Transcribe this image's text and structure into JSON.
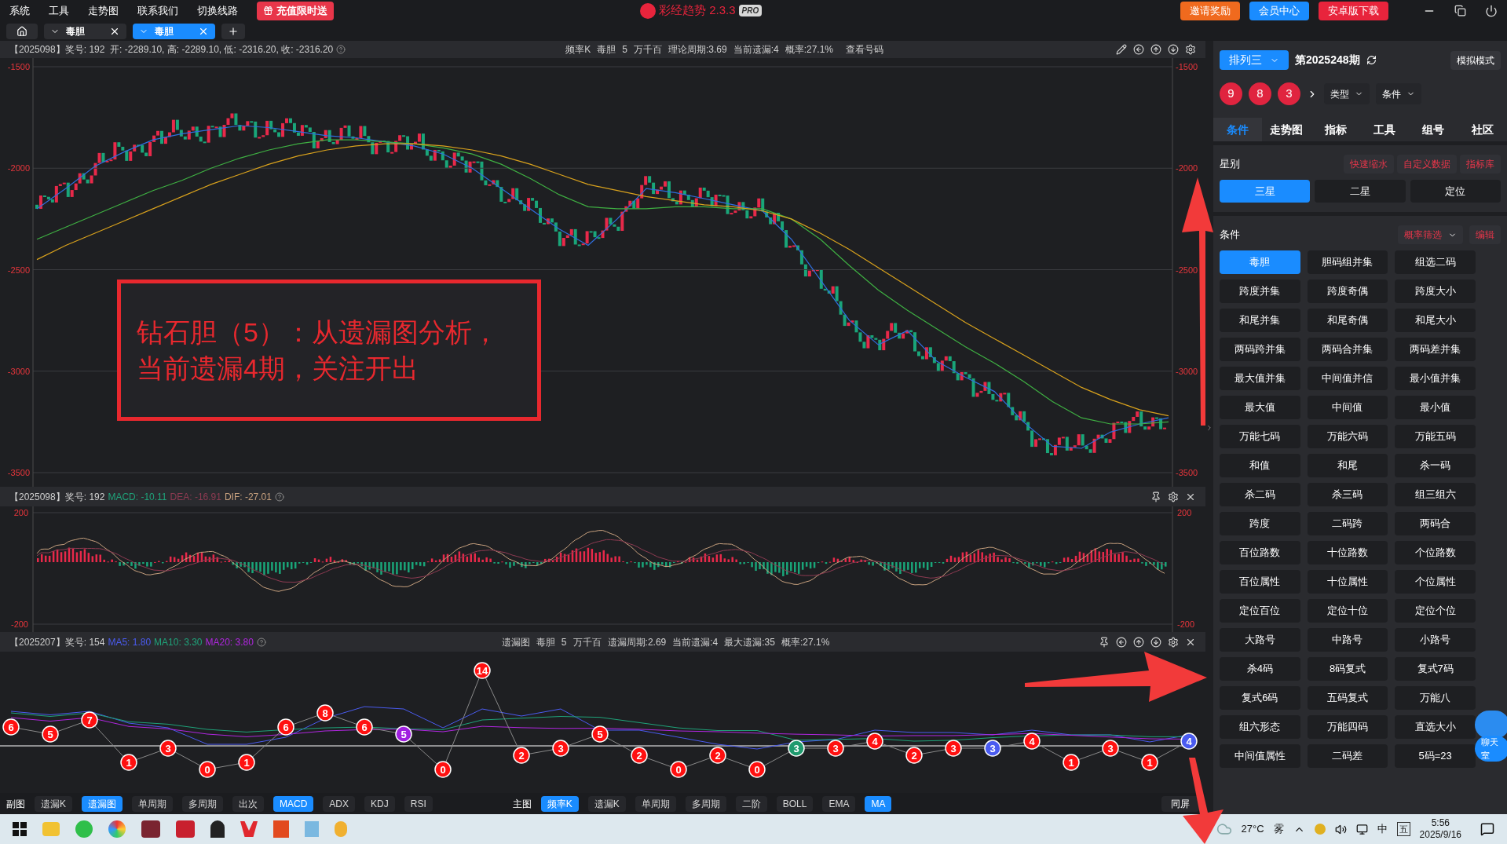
{
  "menu": [
    "系统",
    "工具",
    "走势图",
    "联系我们",
    "切换线路"
  ],
  "promo": "充值限时送",
  "app_title": "彩经趋势 2.3.3",
  "app_badge": "PRO",
  "top_buttons": [
    {
      "label": "邀请奖励",
      "kind": "invite"
    },
    {
      "label": "会员中心",
      "kind": "member"
    },
    {
      "label": "安卓版下载",
      "kind": "download"
    }
  ],
  "doc_tabs": [
    {
      "label": "毒胆",
      "selected": false
    },
    {
      "label": "毒胆",
      "selected": true
    }
  ],
  "main_chart": {
    "info": "【2025098】奖号: 192",
    "ohlc": "开: -2289.10, 高: -2289.10, 低: -2316.20, 收: -2316.20",
    "center": [
      "频率K",
      "毒胆",
      "5",
      "万千百",
      "理论周期:3.69",
      "当前遗漏:4",
      "概率:27.1%"
    ],
    "link": "查看号码",
    "chart_data": {
      "type": "line",
      "grid": true,
      "ylim": [
        -3500,
        -1500
      ],
      "yticks": [
        -1500,
        -2000,
        -2500,
        -3000,
        -3500
      ],
      "series": [
        {
          "color": "#2f6fe0",
          "values": [
            -2200,
            -2100,
            -1990,
            -1920,
            -1860,
            -1830,
            -1810,
            -1790,
            -1800,
            -1820,
            -1840,
            -1850,
            -1870,
            -1890,
            -1930,
            -2000,
            -2100,
            -2200,
            -2300,
            -2380,
            -2250,
            -2100,
            -2120,
            -2150,
            -2180,
            -2210,
            -2350,
            -2550,
            -2750,
            -2870,
            -2800,
            -2950,
            -3030,
            -3100,
            -3250,
            -3370,
            -3380,
            -3300,
            -3260,
            -3230
          ]
        },
        {
          "color": "#3fb043",
          "values": [
            -2350,
            -2290,
            -2230,
            -2170,
            -2110,
            -2060,
            -2000,
            -1950,
            -1910,
            -1880,
            -1860,
            -1860,
            -1870,
            -1880,
            -1900,
            -1930,
            -1980,
            -2050,
            -2130,
            -2190,
            -2200,
            -2200,
            -2190,
            -2190,
            -2200,
            -2200,
            -2250,
            -2350,
            -2480,
            -2600,
            -2700,
            -2790,
            -2880,
            -2960,
            -3050,
            -3150,
            -3230,
            -3260,
            -3260,
            -3250
          ]
        },
        {
          "color": "#d9a21d",
          "values": [
            -2450,
            -2380,
            -2320,
            -2260,
            -2200,
            -2140,
            -2080,
            -2030,
            -1980,
            -1940,
            -1910,
            -1890,
            -1880,
            -1880,
            -1890,
            -1910,
            -1940,
            -1980,
            -2030,
            -2080,
            -2110,
            -2140,
            -2160,
            -2180,
            -2190,
            -2210,
            -2250,
            -2320,
            -2400,
            -2490,
            -2580,
            -2670,
            -2760,
            -2840,
            -2920,
            -3000,
            -3080,
            -3140,
            -3190,
            -3220
          ]
        }
      ]
    },
    "right_ticks": [
      "-1500",
      "-2000",
      "-2500",
      "-3000",
      "-3500"
    ]
  },
  "annotation": [
    "钻石胆（5）：从遗漏图分析，",
    "当前遗漏4期，关注开出"
  ],
  "macd": {
    "info": "【2025098】奖号: 192",
    "indicators": [
      {
        "label": "MACD: -10.11",
        "color": "#1fa37a"
      },
      {
        "label": "DEA: -16.91",
        "color": "#8e3b52"
      },
      {
        "label": "DIF: -27.01",
        "color": "#c9a27f"
      }
    ],
    "left_ticks": [
      "200",
      "-200"
    ],
    "right_ticks": [
      "200",
      "-200"
    ]
  },
  "miss_chart": {
    "info": "【2025207】奖号: 154",
    "indicators": [
      {
        "label": "MA5: 1.80",
        "color": "#4a5bf0"
      },
      {
        "label": "MA10: 3.30",
        "color": "#1fa37a"
      },
      {
        "label": "MA20: 3.80",
        "color": "#b026e0"
      }
    ],
    "center": [
      "遗漏图",
      "毒胆",
      "5",
      "万千百",
      "遗漏周期:2.69",
      "当前遗漏:4",
      "最大遗漏:35",
      "概率:27.1%"
    ],
    "points": [
      {
        "value": "6",
        "color": "#ff1010"
      },
      {
        "value": "5",
        "color": "#ff1010"
      },
      {
        "value": "7",
        "color": "#ff1010"
      },
      {
        "value": "1",
        "color": "#ff1010"
      },
      {
        "value": "3",
        "color": "#ff1010"
      },
      {
        "value": "0",
        "color": "#ff1010"
      },
      {
        "value": "1",
        "color": "#ff1010"
      },
      {
        "value": "6",
        "color": "#ff1010"
      },
      {
        "value": "8",
        "color": "#ff1010"
      },
      {
        "value": "6",
        "color": "#ff1010"
      },
      {
        "value": "5",
        "color": "#a020e0"
      },
      {
        "value": "0",
        "color": "#ff1010"
      },
      {
        "value": "14",
        "color": "#ff1010"
      },
      {
        "value": "2",
        "color": "#ff1010"
      },
      {
        "value": "3",
        "color": "#ff1010"
      },
      {
        "value": "5",
        "color": "#ff1010"
      },
      {
        "value": "2",
        "color": "#ff1010"
      },
      {
        "value": "0",
        "color": "#ff1010"
      },
      {
        "value": "2",
        "color": "#ff1010"
      },
      {
        "value": "0",
        "color": "#ff1010"
      },
      {
        "value": "3",
        "color": "#1f9a6e"
      },
      {
        "value": "3",
        "color": "#ff1010"
      },
      {
        "value": "4",
        "color": "#ff1010"
      },
      {
        "value": "2",
        "color": "#ff1010"
      },
      {
        "value": "3",
        "color": "#ff1010"
      },
      {
        "value": "3",
        "color": "#4a5bf0"
      },
      {
        "value": "4",
        "color": "#ff1010"
      },
      {
        "value": "1",
        "color": "#ff1010"
      },
      {
        "value": "3",
        "color": "#ff1010"
      },
      {
        "value": "1",
        "color": "#ff1010"
      },
      {
        "value": "4",
        "color": "#4a5bf0"
      }
    ]
  },
  "toolbar": {
    "sub_label": "副图",
    "sub": [
      {
        "label": "遗漏K",
        "selected": false
      },
      {
        "label": "遗漏图",
        "selected": true
      },
      {
        "label": "单周期",
        "selected": false
      },
      {
        "label": "多周期",
        "selected": false
      },
      {
        "label": "出次",
        "selected": false
      },
      {
        "label": "MACD",
        "selected": true
      },
      {
        "label": "ADX",
        "selected": false
      },
      {
        "label": "KDJ",
        "selected": false
      },
      {
        "label": "RSI",
        "selected": false
      }
    ],
    "main_label": "主图",
    "main": [
      {
        "label": "频率K",
        "selected": true
      },
      {
        "label": "遗漏K",
        "selected": false
      },
      {
        "label": "单周期",
        "selected": false
      },
      {
        "label": "多周期",
        "selected": false
      },
      {
        "label": "二阶",
        "selected": false
      },
      {
        "label": "BOLL",
        "selected": false
      },
      {
        "label": "EMA",
        "selected": false
      },
      {
        "label": "MA",
        "selected": true
      }
    ],
    "same_screen": "同屏"
  },
  "right_panel": {
    "lottery": "排列三",
    "period": "第2025248期",
    "mode": "模拟模式",
    "balls": [
      "9",
      "8",
      "3"
    ],
    "filters": [
      "类型",
      "条件"
    ],
    "tabs": [
      {
        "label": "条件",
        "selected": true
      },
      {
        "label": "走势图",
        "selected": false
      },
      {
        "label": "指标",
        "selected": false
      },
      {
        "label": "工具",
        "selected": false
      },
      {
        "label": "组号",
        "selected": false
      },
      {
        "label": "社区",
        "selected": false
      }
    ],
    "star_title": "星别",
    "star_links": [
      "快速缩水",
      "自定义数据",
      "指标库"
    ],
    "star_options": [
      {
        "label": "三星",
        "selected": true
      },
      {
        "label": "二星",
        "selected": false
      },
      {
        "label": "定位",
        "selected": false
      }
    ],
    "cond_title": "条件",
    "cond_filter": "概率筛选",
    "cond_edit": "编辑",
    "items": [
      {
        "label": "毒胆",
        "selected": true
      },
      {
        "label": "胆码组并集",
        "selected": false
      },
      {
        "label": "组选二码",
        "selected": false
      },
      {
        "label": "跨度并集",
        "selected": false
      },
      {
        "label": "跨度奇偶",
        "selected": false
      },
      {
        "label": "跨度大小",
        "selected": false
      },
      {
        "label": "和尾并集",
        "selected": false
      },
      {
        "label": "和尾奇偶",
        "selected": false
      },
      {
        "label": "和尾大小",
        "selected": false
      },
      {
        "label": "两码跨并集",
        "selected": false
      },
      {
        "label": "两码合并集",
        "selected": false
      },
      {
        "label": "两码差并集",
        "selected": false
      },
      {
        "label": "最大值并集",
        "selected": false
      },
      {
        "label": "中间值并信",
        "selected": false
      },
      {
        "label": "最小值并集",
        "selected": false
      },
      {
        "label": "最大值",
        "selected": false
      },
      {
        "label": "中间值",
        "selected": false
      },
      {
        "label": "最小值",
        "selected": false
      },
      {
        "label": "万能七码",
        "selected": false
      },
      {
        "label": "万能六码",
        "selected": false
      },
      {
        "label": "万能五码",
        "selected": false
      },
      {
        "label": "和值",
        "selected": false
      },
      {
        "label": "和尾",
        "selected": false
      },
      {
        "label": "杀一码",
        "selected": false
      },
      {
        "label": "杀二码",
        "selected": false
      },
      {
        "label": "杀三码",
        "selected": false
      },
      {
        "label": "组三组六",
        "selected": false
      },
      {
        "label": "跨度",
        "selected": false
      },
      {
        "label": "二码跨",
        "selected": false
      },
      {
        "label": "两码合",
        "selected": false
      },
      {
        "label": "百位路数",
        "selected": false
      },
      {
        "label": "十位路数",
        "selected": false
      },
      {
        "label": "个位路数",
        "selected": false
      },
      {
        "label": "百位属性",
        "selected": false
      },
      {
        "label": "十位属性",
        "selected": false
      },
      {
        "label": "个位属性",
        "selected": false
      },
      {
        "label": "定位百位",
        "selected": false
      },
      {
        "label": "定位十位",
        "selected": false
      },
      {
        "label": "定位个位",
        "selected": false
      },
      {
        "label": "大路号",
        "selected": false
      },
      {
        "label": "中路号",
        "selected": false
      },
      {
        "label": "小路号",
        "selected": false
      },
      {
        "label": "杀4码",
        "selected": false
      },
      {
        "label": "8码复式",
        "selected": false
      },
      {
        "label": "复式7码",
        "selected": false
      },
      {
        "label": "复式6码",
        "selected": false
      },
      {
        "label": "五码复式",
        "selected": false
      },
      {
        "label": "万能八",
        "selected": false
      },
      {
        "label": "组六形态",
        "selected": false
      },
      {
        "label": "万能四码",
        "selected": false
      },
      {
        "label": "直选大小",
        "selected": false
      },
      {
        "label": "中间值属性",
        "selected": false
      },
      {
        "label": "二码差",
        "selected": false
      },
      {
        "label": "5码=23",
        "selected": false
      }
    ],
    "chat": "聊天室"
  },
  "taskbar": {
    "temperature": "27°C",
    "weather": "雾",
    "ime": "中",
    "ime_mode": "五",
    "time": "5:56",
    "date": "2025/9/16"
  }
}
